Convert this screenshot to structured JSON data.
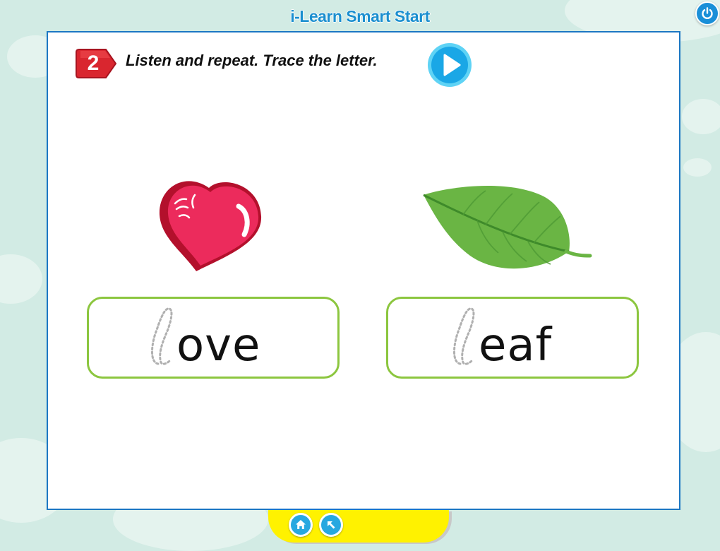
{
  "app": {
    "title": "i-Learn Smart Start"
  },
  "header": {
    "power_icon": "power-icon"
  },
  "activity": {
    "number": "2",
    "instruction": "Listen and repeat. Trace the letter.",
    "audio_icon": "play-icon"
  },
  "items": [
    {
      "picture": "heart-icon",
      "trace_letter": "l",
      "rest": "ove"
    },
    {
      "picture": "leaf-icon",
      "trace_letter": "l",
      "rest": "eaf"
    }
  ],
  "colors": {
    "background": "#d2ebe4",
    "panel_border": "#1c77c3",
    "title": "#1b8fcf",
    "badge": "#d9262f",
    "audio_button": "#1aa7e6",
    "word_box_border": "#8cc63f",
    "bottom_bar": "#fff200"
  },
  "footer": {
    "home_icon": "home-icon",
    "back_icon": "back-arrow-icon"
  }
}
